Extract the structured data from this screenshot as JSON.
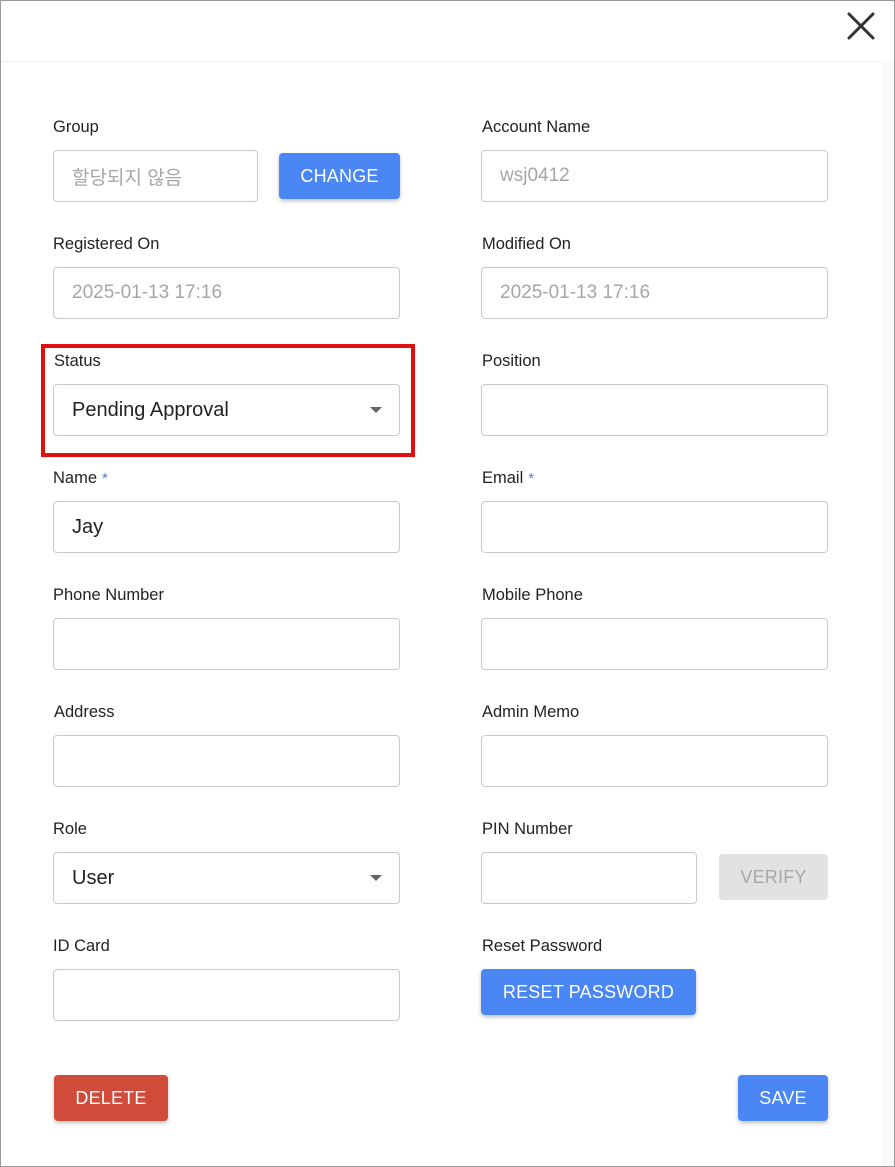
{
  "dialog": {
    "close_icon": "close-icon"
  },
  "group": {
    "label": "Group",
    "value": "할당되지 않음",
    "change_label": "CHANGE"
  },
  "account_name": {
    "label": "Account Name",
    "value": "wsj0412"
  },
  "registered_on": {
    "label": "Registered On",
    "value": "2025-01-13 17:16"
  },
  "modified_on": {
    "label": "Modified On",
    "value": "2025-01-13 17:16"
  },
  "status": {
    "label": "Status",
    "selected": "Pending Approval"
  },
  "position": {
    "label": "Position",
    "value": ""
  },
  "name": {
    "label": "Name",
    "required_mark": "*",
    "value": "Jay"
  },
  "email": {
    "label": "Email",
    "required_mark": "*",
    "value": ""
  },
  "phone_number": {
    "label": "Phone Number",
    "value": ""
  },
  "mobile_phone": {
    "label": "Mobile Phone",
    "value": ""
  },
  "address": {
    "label": "Address",
    "value": ""
  },
  "admin_memo": {
    "label": "Admin Memo",
    "value": ""
  },
  "role": {
    "label": "Role",
    "selected": "User"
  },
  "pin_number": {
    "label": "PIN Number",
    "value": "",
    "verify_label": "VERIFY"
  },
  "id_card": {
    "label": "ID Card",
    "value": ""
  },
  "reset_password": {
    "label": "Reset Password",
    "button_label": "RESET PASSWORD"
  },
  "footer": {
    "delete_label": "DELETE",
    "save_label": "SAVE"
  },
  "colors": {
    "primary": "#4a86f4",
    "danger": "#d04b3a",
    "required": "#4a7dde",
    "highlight": "#e01010"
  }
}
